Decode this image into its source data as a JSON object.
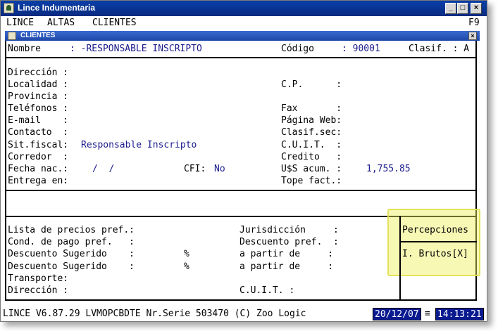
{
  "window": {
    "title": "Lince Indumentaria",
    "colors": {
      "titlebar": "#0a2a80",
      "value_text": "#1a1a8c",
      "highlight": "#f0f05a"
    }
  },
  "menu": {
    "items": [
      "LINCE",
      "ALTAS",
      "CLIENTES"
    ],
    "shortcut": "F9"
  },
  "dialog": {
    "title": "CLIENTES"
  },
  "header": {
    "nombre_label": "Nombre",
    "nombre_value": ": -RESPONSABLE INSCRIPTO",
    "codigo_label": "Código",
    "codigo_value": ": 90001",
    "clasif_label": "Clasif. : A"
  },
  "left_fields": [
    {
      "label": "Dirección :"
    },
    {
      "label": "Localidad :"
    },
    {
      "label": "Provincia :"
    },
    {
      "label": "Teléfonos :"
    },
    {
      "label": "E-mail    :"
    },
    {
      "label": "Contacto  :"
    },
    {
      "label": "Sit.fiscal:",
      "value": "Responsable Inscripto"
    },
    {
      "label": "Corredor  :"
    },
    {
      "label": "Fecha nac.:",
      "value": "/  /"
    },
    {
      "label": "Entrega en:"
    }
  ],
  "cfi": {
    "label": "CFI:",
    "value": "No"
  },
  "right_fields": [
    {
      "label": "C.P.      :"
    },
    {
      "label": "Fax       :"
    },
    {
      "label": "Página Web:"
    },
    {
      "label": "Clasif.sec:"
    },
    {
      "label": "C.U.I.T.  :"
    },
    {
      "label": "Credito   :"
    },
    {
      "label": "U$S acum. :",
      "value": "1,755.85"
    },
    {
      "label": "Tope fact.:"
    }
  ],
  "lower_left": [
    {
      "label": "Lista de precios pref.:"
    },
    {
      "label": "Cond. de pago pref.   :"
    },
    {
      "label": "Descuento Sugerido    :",
      "suffix": "%"
    },
    {
      "label": "Descuento Sugerido    :",
      "suffix": "%"
    },
    {
      "label": "Transporte:"
    },
    {
      "label": "Dirección :"
    }
  ],
  "lower_mid": [
    {
      "label": "Jurisdicción     :"
    },
    {
      "label": "Descuento pref.  :"
    },
    {
      "label": "a partir de     :"
    },
    {
      "label": "a partir de     :"
    },
    {
      "label": "C.U.I.T. :"
    }
  ],
  "percepciones": {
    "title": "Percepciones",
    "item": "I. Brutos[X]"
  },
  "status": {
    "text": "LINCE   V6.87.29  LVMOPCBDTE Nr.Serie 503470 (C) Zoo Logic",
    "date": "20/12/07",
    "separator": "≡",
    "time": "14:13:21"
  }
}
